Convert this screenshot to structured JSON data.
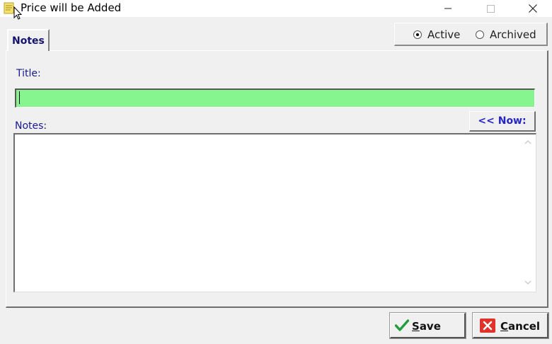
{
  "window": {
    "title": "Price will be Added",
    "icon": "notepad-icon",
    "controls": [
      "minimize-icon",
      "maximize-icon",
      "close-icon"
    ]
  },
  "tabs": [
    {
      "label": "Notes",
      "active": true
    }
  ],
  "status": {
    "options": [
      {
        "label": "Active",
        "checked": true
      },
      {
        "label": "Archived",
        "checked": false
      }
    ]
  },
  "form": {
    "title_label": "Title:",
    "title_value": "",
    "title_bg_color": "#86f58f",
    "notes_label": "Notes:",
    "notes_value": "",
    "now_button_label": "<< Now:"
  },
  "buttons": {
    "save": {
      "label_first": "S",
      "label_rest": "ave",
      "icon": "checkmark-icon",
      "icon_color": "#1f9d3a"
    },
    "cancel": {
      "label_first": "C",
      "label_rest": "ancel",
      "icon": "x-cross-icon",
      "icon_color": "#e0312b"
    }
  }
}
